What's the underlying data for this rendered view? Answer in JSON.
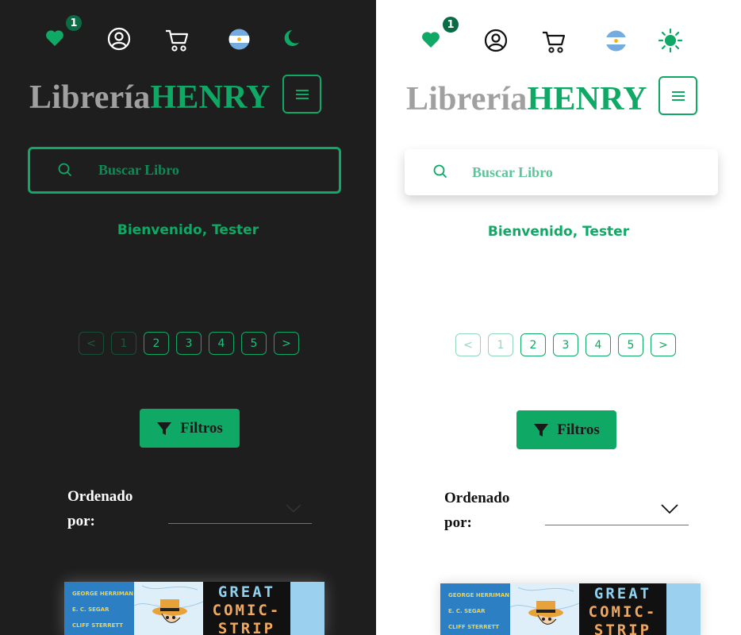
{
  "colors": {
    "accent": "#0fa865",
    "dark_bg": "#1e1e1e",
    "light_bg": "#ffffff",
    "logo_grey": "#a0a0a0"
  },
  "panels": [
    {
      "theme": "dark",
      "header": {
        "favorites_count": "1",
        "icons": [
          "heart-icon",
          "user-icon",
          "cart-icon",
          "argentina-flag-icon",
          "moon-icon"
        ]
      },
      "logo": {
        "part1": "Librería",
        "part2": "HENRY"
      },
      "search": {
        "placeholder": "Buscar Libro"
      },
      "welcome": "Bienvenido, Tester",
      "pagination": {
        "prev": "<",
        "pages": [
          "1",
          "2",
          "3",
          "4",
          "5"
        ],
        "next": ">",
        "current": "1"
      },
      "filters_label": "Filtros",
      "sort": {
        "label": "Ordenado por:",
        "value": ""
      },
      "book": {
        "authors": [
          "GEORGE HERRIMAN",
          "E. C. SEGAR",
          "CLIFF STERRETT"
        ],
        "title_lines": [
          "GREAT",
          "COMIC-",
          "STRIP"
        ]
      }
    },
    {
      "theme": "light",
      "header": {
        "favorites_count": "1",
        "icons": [
          "heart-icon",
          "user-icon",
          "cart-icon",
          "argentina-flag-icon",
          "sun-icon"
        ]
      },
      "logo": {
        "part1": "Librería",
        "part2": "HENRY"
      },
      "search": {
        "placeholder": "Buscar Libro"
      },
      "welcome": "Bienvenido, Tester",
      "pagination": {
        "prev": "<",
        "pages": [
          "1",
          "2",
          "3",
          "4",
          "5"
        ],
        "next": ">",
        "current": "1"
      },
      "filters_label": "Filtros",
      "sort": {
        "label": "Ordenado por:",
        "value": ""
      },
      "book": {
        "authors": [
          "GEORGE HERRIMAN",
          "E. C. SEGAR",
          "CLIFF STERRETT"
        ],
        "title_lines": [
          "GREAT",
          "COMIC-",
          "STRIP"
        ]
      }
    }
  ]
}
